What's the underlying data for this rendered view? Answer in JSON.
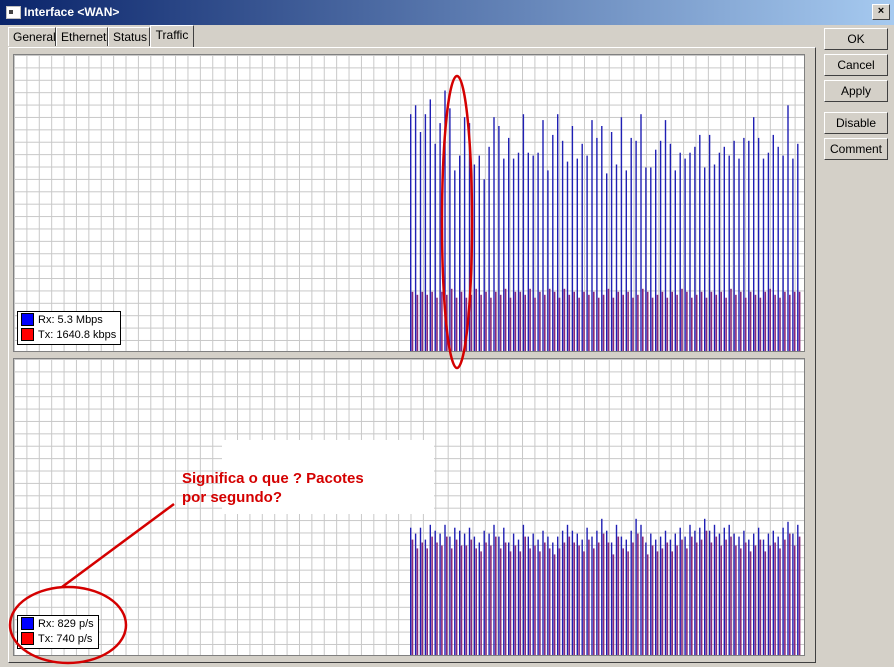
{
  "window": {
    "title": "Interface <WAN>",
    "close_label": "×"
  },
  "tabs": [
    {
      "label": "General",
      "active": false
    },
    {
      "label": "Ethernet",
      "active": false
    },
    {
      "label": "Status",
      "active": false
    },
    {
      "label": "Traffic",
      "active": true
    }
  ],
  "buttons": {
    "ok": "OK",
    "cancel": "Cancel",
    "apply": "Apply",
    "disable": "Disable",
    "comment": "Comment"
  },
  "colors": {
    "rx": "#0000ff",
    "tx": "#ff0000",
    "bar_rx": "#1f1fb4",
    "bar_tx": "#8a2a78",
    "annotation": "#d40000",
    "accent_title": "#0a246a"
  },
  "graphs": {
    "traffic": {
      "legend_rx": "Rx: 5.3 Mbps",
      "legend_tx": "Tx: 1640.8 kbps"
    },
    "packets": {
      "legend_rx": "Rx: 829 p/s",
      "legend_tx": "Tx: 740 p/s"
    }
  },
  "annotation": {
    "line1": "Significa o que ? Pacotes",
    "line2": "por segundo?"
  },
  "chart_data": [
    {
      "type": "bar",
      "title": "",
      "series": [
        {
          "name": "Rx: 5.3 Mbps",
          "values": [
            0.8,
            0.83,
            0.74,
            0.8,
            0.85,
            0.7,
            0.77,
            0.88,
            0.82,
            0.61,
            0.66,
            0.79,
            0.77,
            0.63,
            0.66,
            0.58,
            0.69,
            0.79,
            0.76,
            0.65,
            0.72,
            0.65,
            0.67,
            0.8,
            0.67,
            0.66,
            0.67,
            0.78,
            0.61,
            0.73,
            0.8,
            0.71,
            0.64,
            0.76,
            0.65,
            0.7,
            0.66,
            0.78,
            0.72,
            0.76,
            0.6,
            0.74,
            0.63,
            0.79,
            0.61,
            0.72,
            0.71,
            0.8,
            0.62,
            0.62,
            0.68,
            0.71,
            0.78,
            0.7,
            0.61,
            0.67,
            0.65,
            0.67,
            0.69,
            0.73,
            0.62,
            0.73,
            0.63,
            0.67,
            0.69,
            0.66,
            0.71,
            0.65,
            0.72,
            0.71,
            0.79,
            0.72,
            0.65,
            0.67,
            0.73,
            0.69,
            0.66,
            0.83,
            0.65,
            0.7
          ]
        },
        {
          "name": "Tx: 1640.8 kbps",
          "values": [
            0.2,
            0.19,
            0.2,
            0.19,
            0.2,
            0.18,
            0.2,
            0.19,
            0.21,
            0.18,
            0.2,
            0.18,
            0.19,
            0.21,
            0.19,
            0.2,
            0.18,
            0.2,
            0.19,
            0.21,
            0.18,
            0.2,
            0.2,
            0.19,
            0.21,
            0.18,
            0.2,
            0.19,
            0.21,
            0.2,
            0.18,
            0.21,
            0.19,
            0.2,
            0.18,
            0.2,
            0.19,
            0.2,
            0.18,
            0.19,
            0.21,
            0.18,
            0.2,
            0.19,
            0.2,
            0.18,
            0.19,
            0.21,
            0.2,
            0.18,
            0.19,
            0.2,
            0.18,
            0.2,
            0.19,
            0.21,
            0.2,
            0.18,
            0.19,
            0.2,
            0.18,
            0.2,
            0.19,
            0.2,
            0.18,
            0.21,
            0.19,
            0.2,
            0.18,
            0.2,
            0.19,
            0.18,
            0.2,
            0.21,
            0.19,
            0.18,
            0.2,
            0.19,
            0.2,
            0.2
          ]
        }
      ],
      "ylim": [
        0,
        1
      ]
    },
    {
      "type": "bar",
      "title": "",
      "series": [
        {
          "name": "Rx: 829 p/s",
          "values": [
            0.43,
            0.41,
            0.43,
            0.39,
            0.44,
            0.42,
            0.41,
            0.44,
            0.4,
            0.43,
            0.42,
            0.41,
            0.43,
            0.4,
            0.38,
            0.42,
            0.41,
            0.44,
            0.4,
            0.43,
            0.38,
            0.41,
            0.39,
            0.44,
            0.4,
            0.41,
            0.39,
            0.42,
            0.4,
            0.38,
            0.4,
            0.42,
            0.44,
            0.42,
            0.41,
            0.39,
            0.43,
            0.4,
            0.42,
            0.46,
            0.42,
            0.38,
            0.44,
            0.4,
            0.39,
            0.42,
            0.46,
            0.44,
            0.38,
            0.41,
            0.39,
            0.4,
            0.42,
            0.39,
            0.41,
            0.43,
            0.4,
            0.44,
            0.42,
            0.43,
            0.46,
            0.42,
            0.44,
            0.41,
            0.43,
            0.44,
            0.41,
            0.4,
            0.42,
            0.39,
            0.41,
            0.43,
            0.39,
            0.41,
            0.42,
            0.4,
            0.43,
            0.45,
            0.41,
            0.44
          ]
        },
        {
          "name": "Tx: 740 p/s",
          "values": [
            0.39,
            0.36,
            0.38,
            0.36,
            0.4,
            0.38,
            0.37,
            0.4,
            0.36,
            0.39,
            0.37,
            0.37,
            0.39,
            0.36,
            0.35,
            0.38,
            0.37,
            0.4,
            0.36,
            0.38,
            0.35,
            0.37,
            0.35,
            0.4,
            0.36,
            0.37,
            0.35,
            0.38,
            0.36,
            0.34,
            0.36,
            0.38,
            0.4,
            0.38,
            0.37,
            0.35,
            0.39,
            0.36,
            0.38,
            0.41,
            0.38,
            0.34,
            0.4,
            0.36,
            0.35,
            0.38,
            0.41,
            0.4,
            0.34,
            0.37,
            0.35,
            0.36,
            0.38,
            0.35,
            0.37,
            0.39,
            0.36,
            0.4,
            0.38,
            0.39,
            0.42,
            0.38,
            0.4,
            0.37,
            0.39,
            0.4,
            0.37,
            0.36,
            0.38,
            0.35,
            0.37,
            0.39,
            0.35,
            0.37,
            0.38,
            0.36,
            0.39,
            0.41,
            0.37,
            0.4
          ]
        }
      ],
      "ylim": [
        0,
        1
      ]
    }
  ]
}
